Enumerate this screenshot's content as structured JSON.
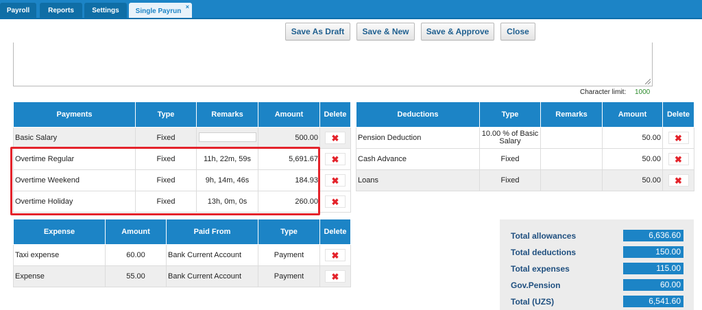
{
  "tabs": [
    {
      "label": "Payroll"
    },
    {
      "label": "Reports"
    },
    {
      "label": "Settings"
    },
    {
      "label": "Single Payrun",
      "close": "×"
    }
  ],
  "toolbar": {
    "save_draft": "Save As Draft",
    "save_new": "Save & New",
    "save_approve": "Save & Approve",
    "close": "Close"
  },
  "notes": {
    "char_limit_label": "Character limit:",
    "char_limit_value": "1000"
  },
  "payments": {
    "headers": {
      "name": "Payments",
      "type": "Type",
      "remarks": "Remarks",
      "amount": "Amount",
      "delete": "Delete"
    },
    "rows": [
      {
        "name": "Basic Salary",
        "type": "Fixed",
        "remarks": "",
        "amount": "500.00"
      },
      {
        "name": "Overtime Regular",
        "type": "Fixed",
        "remarks": "11h, 22m, 59s",
        "amount": "5,691.67"
      },
      {
        "name": "Overtime Weekend",
        "type": "Fixed",
        "remarks": "9h, 14m, 46s",
        "amount": "184.93"
      },
      {
        "name": "Overtime Holiday",
        "type": "Fixed",
        "remarks": "13h, 0m, 0s",
        "amount": "260.00"
      }
    ]
  },
  "deductions": {
    "headers": {
      "name": "Deductions",
      "type": "Type",
      "remarks": "Remarks",
      "amount": "Amount",
      "delete": "Delete"
    },
    "rows": [
      {
        "name": "Pension Deduction",
        "type": "10.00 % of Basic Salary",
        "remarks": "",
        "amount": "50.00"
      },
      {
        "name": "Cash Advance",
        "type": "Fixed",
        "remarks": "",
        "amount": "50.00"
      },
      {
        "name": "Loans",
        "type": "Fixed",
        "remarks": "",
        "amount": "50.00"
      }
    ]
  },
  "expenses": {
    "headers": {
      "name": "Expense",
      "amount": "Amount",
      "paid_from": "Paid From",
      "type": "Type",
      "delete": "Delete"
    },
    "rows": [
      {
        "name": "Taxi expense",
        "amount": "60.00",
        "paid_from": "Bank Current Account",
        "type": "Payment"
      },
      {
        "name": "Expense",
        "amount": "55.00",
        "paid_from": "Bank Current Account",
        "type": "Payment"
      }
    ]
  },
  "delete_icon": "✖",
  "totals": [
    {
      "label": "Total allowances",
      "value": "6,636.60"
    },
    {
      "label": "Total deductions",
      "value": "150.00"
    },
    {
      "label": "Total expenses",
      "value": "115.00"
    },
    {
      "label": "Gov.Pension",
      "value": "60.00"
    },
    {
      "label": "Total (UZS)",
      "value": "6,541.60"
    }
  ]
}
